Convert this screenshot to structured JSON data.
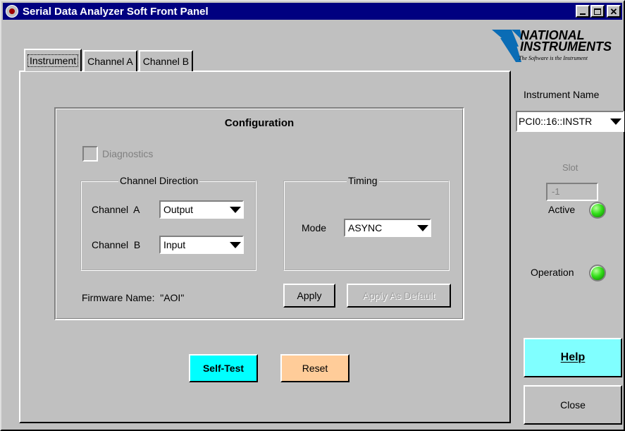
{
  "window": {
    "title": "Serial Data Analyzer Soft Front Panel"
  },
  "tabs": [
    {
      "label": "Instrument",
      "active": true
    },
    {
      "label": "Channel A",
      "active": false
    },
    {
      "label": "Channel B",
      "active": false
    }
  ],
  "configuration": {
    "title": "Configuration",
    "diagnostics_label": "Diagnostics",
    "channel_direction": {
      "title": "Channel Direction",
      "channel_a_label": "Channel  A",
      "channel_a_value": "Output",
      "channel_b_label": "Channel  B",
      "channel_b_value": "Input"
    },
    "timing": {
      "title": "Timing",
      "mode_label": "Mode",
      "mode_value": "ASYNC"
    },
    "firmware_label": "Firmware Name:  \"AOI\"",
    "apply_label": "Apply",
    "apply_default_label": "Apply As Default"
  },
  "buttons": {
    "self_test": "Self-Test",
    "reset": "Reset",
    "help": "Help",
    "close": "Close"
  },
  "side": {
    "logo_line1": "NATIONAL",
    "logo_line2": "INSTRUMENTS",
    "logo_tagline": "The Software is the Instrument",
    "instrument_name_label": "Instrument Name",
    "instrument_name_value": "PCI0::16::INSTR",
    "slot_label": "Slot",
    "slot_value": "-1",
    "active_label": "Active",
    "operation_label": "Operation"
  },
  "colors": {
    "titlebar": "#000080",
    "self_test_bg": "#00ffff",
    "reset_bg": "#ffcc99",
    "help_bg": "#80ffff",
    "led_green": "#34e01a"
  }
}
